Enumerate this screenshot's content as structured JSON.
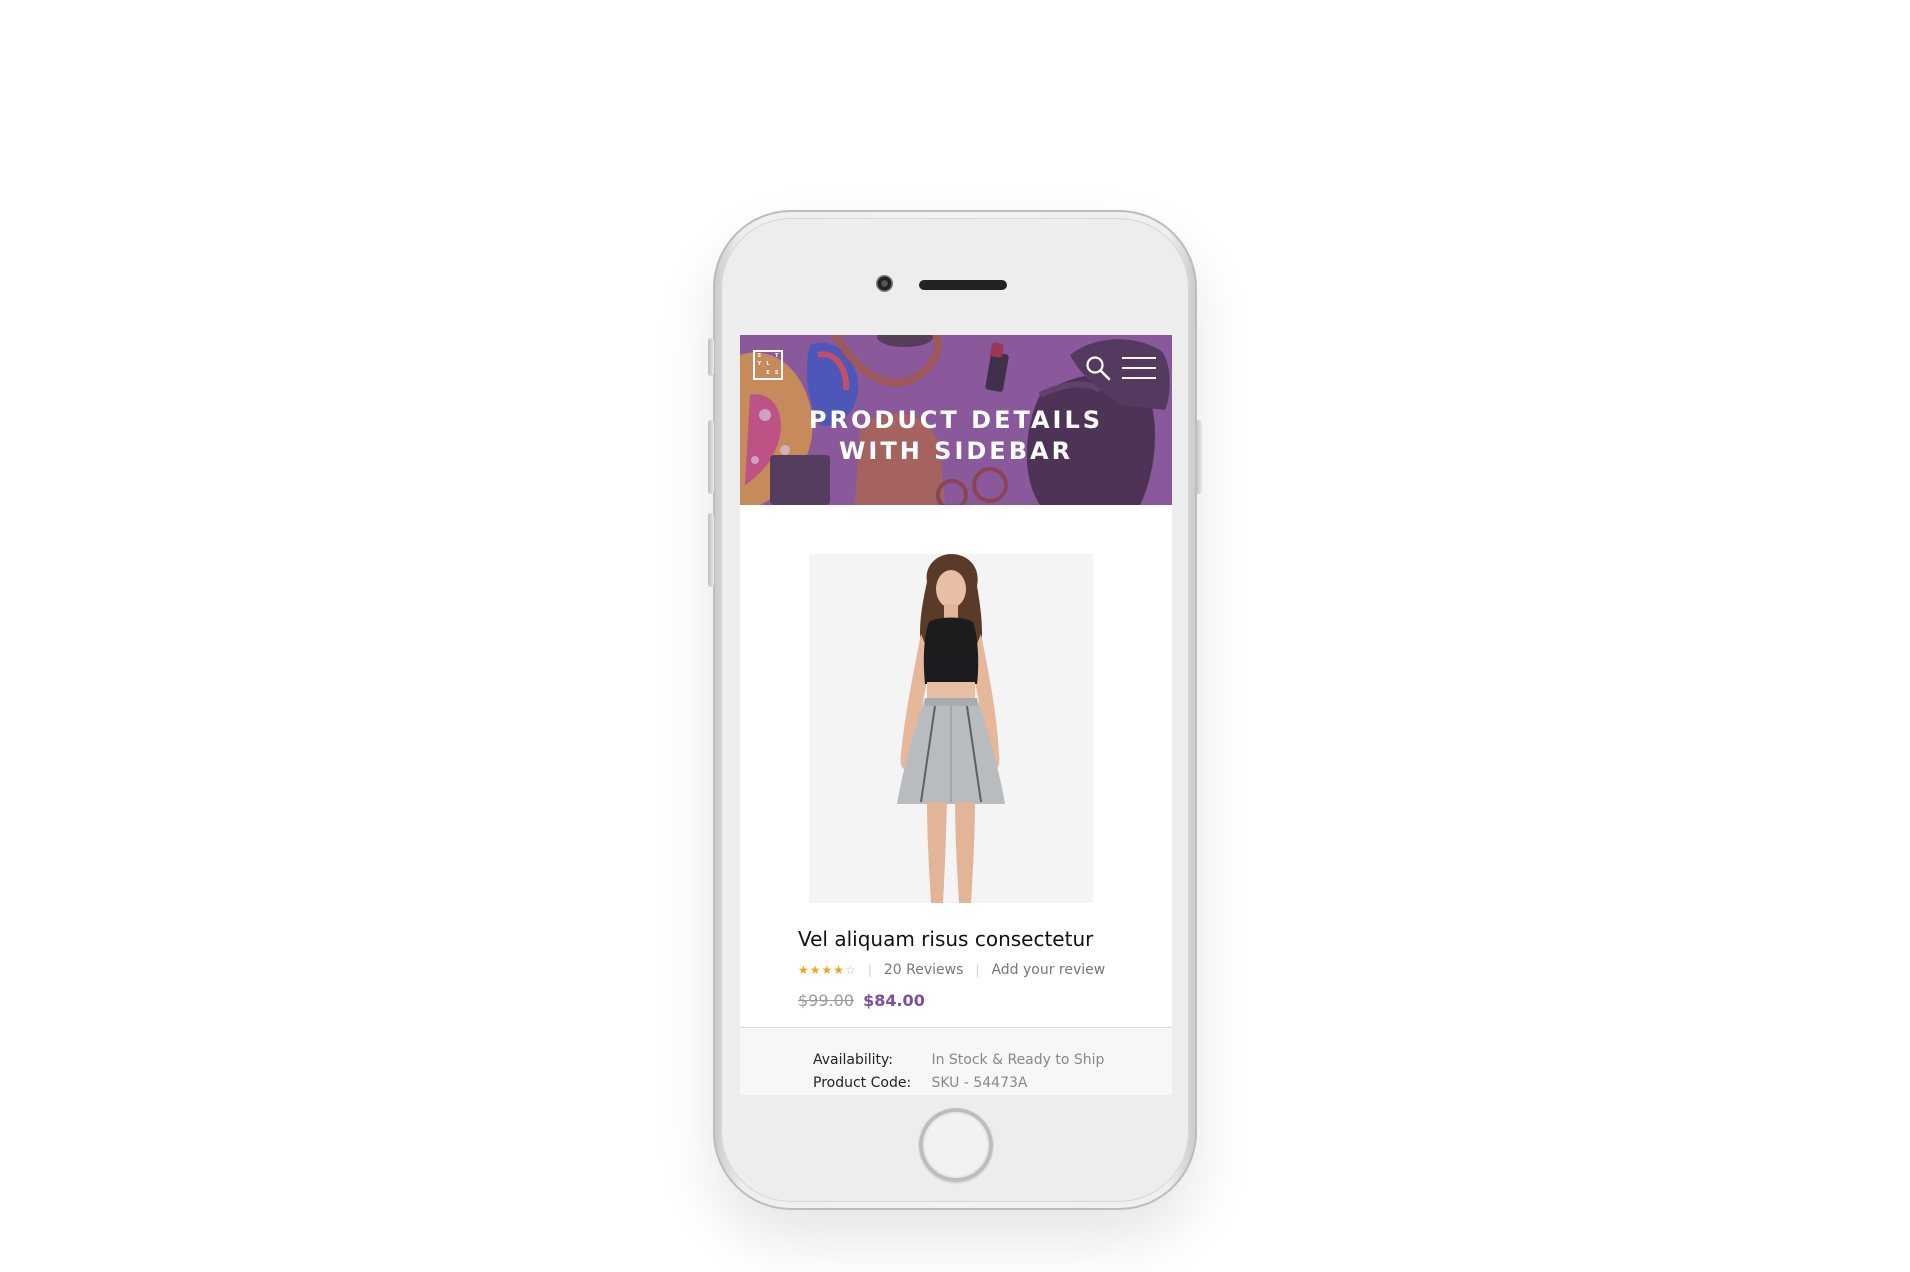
{
  "hero": {
    "title_line1": "PRODUCT DETAILS",
    "title_line2": "WITH SIDEBAR",
    "logo_letters": [
      "S",
      "",
      "T",
      "Y",
      "L",
      "",
      "",
      "E",
      "S"
    ],
    "background_color": "#8a5a9c"
  },
  "header_icons": {
    "search": "search-icon",
    "menu": "hamburger-menu-icon"
  },
  "product": {
    "title": "Vel aliquam risus consectetur",
    "rating": 4,
    "rating_max": 5,
    "reviews_label": "20 Reviews",
    "add_review_label": "Add your review",
    "price_old": "$99.00",
    "price_new": "$84.00"
  },
  "details": [
    {
      "label": "Availability:",
      "value": "In Stock & Ready to Ship"
    },
    {
      "label": "Product Code:",
      "value": "SKU - 54473A"
    }
  ],
  "colors": {
    "accent": "#7a4fa0",
    "star": "#f2a41a"
  }
}
